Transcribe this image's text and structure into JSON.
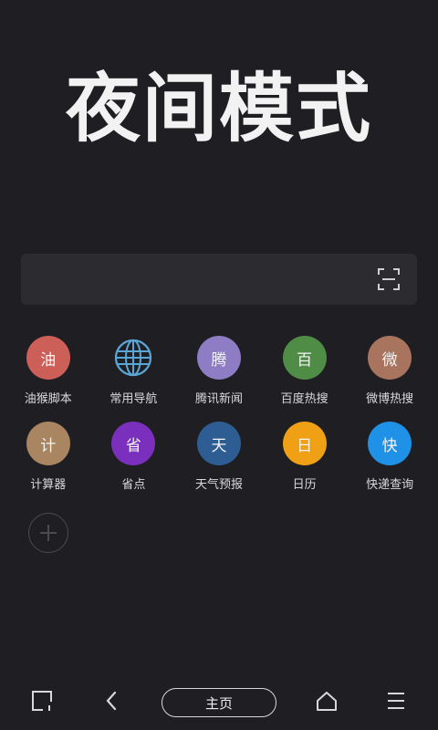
{
  "header": {
    "title": "夜间模式"
  },
  "search": {
    "icon": "scan-icon"
  },
  "shortcuts": [
    {
      "glyph": "油",
      "label": "油猴脚本",
      "color": "#cc5f57",
      "icon": "oil-script-icon"
    },
    {
      "glyph": "",
      "label": "常用导航",
      "color": "transparent",
      "icon": "globe-icon"
    },
    {
      "glyph": "腾",
      "label": "腾讯新闻",
      "color": "#8e7dc4",
      "icon": "tencent-news-icon"
    },
    {
      "glyph": "百",
      "label": "百度热搜",
      "color": "#4f8d47",
      "icon": "baidu-hot-icon"
    },
    {
      "glyph": "微",
      "label": "微博热搜",
      "color": "#a9745e",
      "icon": "weibo-hot-icon"
    },
    {
      "glyph": "计",
      "label": "计算器",
      "color": "#a98561",
      "icon": "calculator-icon"
    },
    {
      "glyph": "省",
      "label": "省点",
      "color": "#7a2fbd",
      "icon": "shengdian-icon"
    },
    {
      "glyph": "天",
      "label": "天气预报",
      "color": "#2e5d93",
      "icon": "weather-icon"
    },
    {
      "glyph": "日",
      "label": "日历",
      "color": "#f0a015",
      "icon": "calendar-icon"
    },
    {
      "glyph": "快",
      "label": "快递查询",
      "color": "#1f91e6",
      "icon": "express-icon"
    }
  ],
  "add_button": {
    "icon": "plus-icon"
  },
  "bottom_nav": {
    "home_label": "主页",
    "icons": [
      "window-icon",
      "back-icon",
      "home-icon",
      "menu-icon"
    ]
  }
}
